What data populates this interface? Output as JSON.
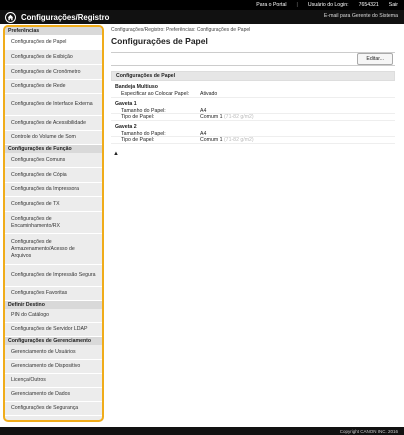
{
  "topbar": {
    "portal_link": "Para o Portal",
    "login_user_label": "Usuário do Login:",
    "login_user_value": "7654321",
    "logout_link": "Sair"
  },
  "header": {
    "title": "Configurações/Registro",
    "system_manager_mode": "E-mail para Gerente do Sistema"
  },
  "sidebar": {
    "sections": [
      {
        "title": "Preferências",
        "items": [
          "Configurações de Papel",
          "Configurações de Exibição",
          "Configurações de Cronômetro",
          "Configurações de Rede",
          "Configurações de Interface Externa",
          "Configurações de Acessibilidade",
          "Controle do Volume de Som"
        ]
      },
      {
        "title": "Configurações de Função",
        "items": [
          "Configurações Comuns",
          "Configurações de Cópia",
          "Configurações da Impressora",
          "Configurações de TX",
          "Configurações de Encaminhamento/RX",
          "Configurações de Armazenamento/Acesso de Arquivos",
          "Configurações de Impressão Segura",
          "Configurações Favoritas"
        ]
      },
      {
        "title": "Definir Destino",
        "items": [
          "PIN do Catálogo",
          "Configurações de Servidor LDAP"
        ]
      },
      {
        "title": "Configurações de Gerenciamento",
        "items": [
          "Gerenciamento de Usuários",
          "Gerenciamento de Dispositivo",
          "Licença/Outros",
          "Gerenciamento de Dados",
          "Configurações de Segurança"
        ]
      }
    ]
  },
  "main": {
    "breadcrumb": "Configurações/Registro: Preferências: Configurações de Papel",
    "title": "Configurações de Papel",
    "edit_button": "Editar...",
    "section_title": "Configurações de Papel",
    "groups": [
      {
        "title": "Bandeja Multiuso",
        "rows": [
          {
            "label": "Especificar ao Colocar Papel:",
            "value": "Ativado",
            "extra": ""
          }
        ]
      },
      {
        "title": "Gaveta 1",
        "rows": [
          {
            "label": "Tamanho do Papel:",
            "value": "A4",
            "extra": ""
          },
          {
            "label": "Tipo de Papel:",
            "value": "Comum 1",
            "extra": "(71-82 g/m2)"
          }
        ]
      },
      {
        "title": "Gaveta 2",
        "rows": [
          {
            "label": "Tamanho do Papel:",
            "value": "A4",
            "extra": ""
          },
          {
            "label": "Tipo de Papel:",
            "value": "Comum 1",
            "extra": "(71-82 g/m2)"
          }
        ]
      }
    ],
    "top_link": "▲"
  },
  "footer": {
    "copyright": "Copyright CANON INC. 2016"
  }
}
